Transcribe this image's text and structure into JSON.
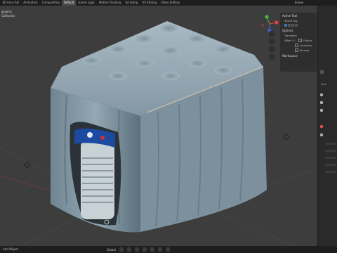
{
  "topbar": {
    "tabs": [
      "3D Auto Full",
      "Animation",
      "Compositing",
      "Default",
      "Game Logic",
      "Motion Tracking",
      "Scripting",
      "UV Editing",
      "Video Editing"
    ],
    "active_tab": "Default",
    "scene": "Scene"
  },
  "viewport": {
    "title": "graphic",
    "collection": "Collection"
  },
  "tool_panel": {
    "active_tool": "Active Tool",
    "select_box": "Select Box",
    "options": "Options",
    "transform": "Transform",
    "affect_only": "Affect O...",
    "origins": "Origins",
    "locations": "Locations",
    "parents": "Parents",
    "workspace": "Workspace"
  },
  "properties": {
    "scene_label": "Scen"
  },
  "statusbar": {
    "left": "Add  Object",
    "mode": "Global"
  },
  "colors": {
    "viewport_bg": "#3d3d3d",
    "object": "#8fa3ad",
    "label_blue": "#1b4aa0"
  }
}
